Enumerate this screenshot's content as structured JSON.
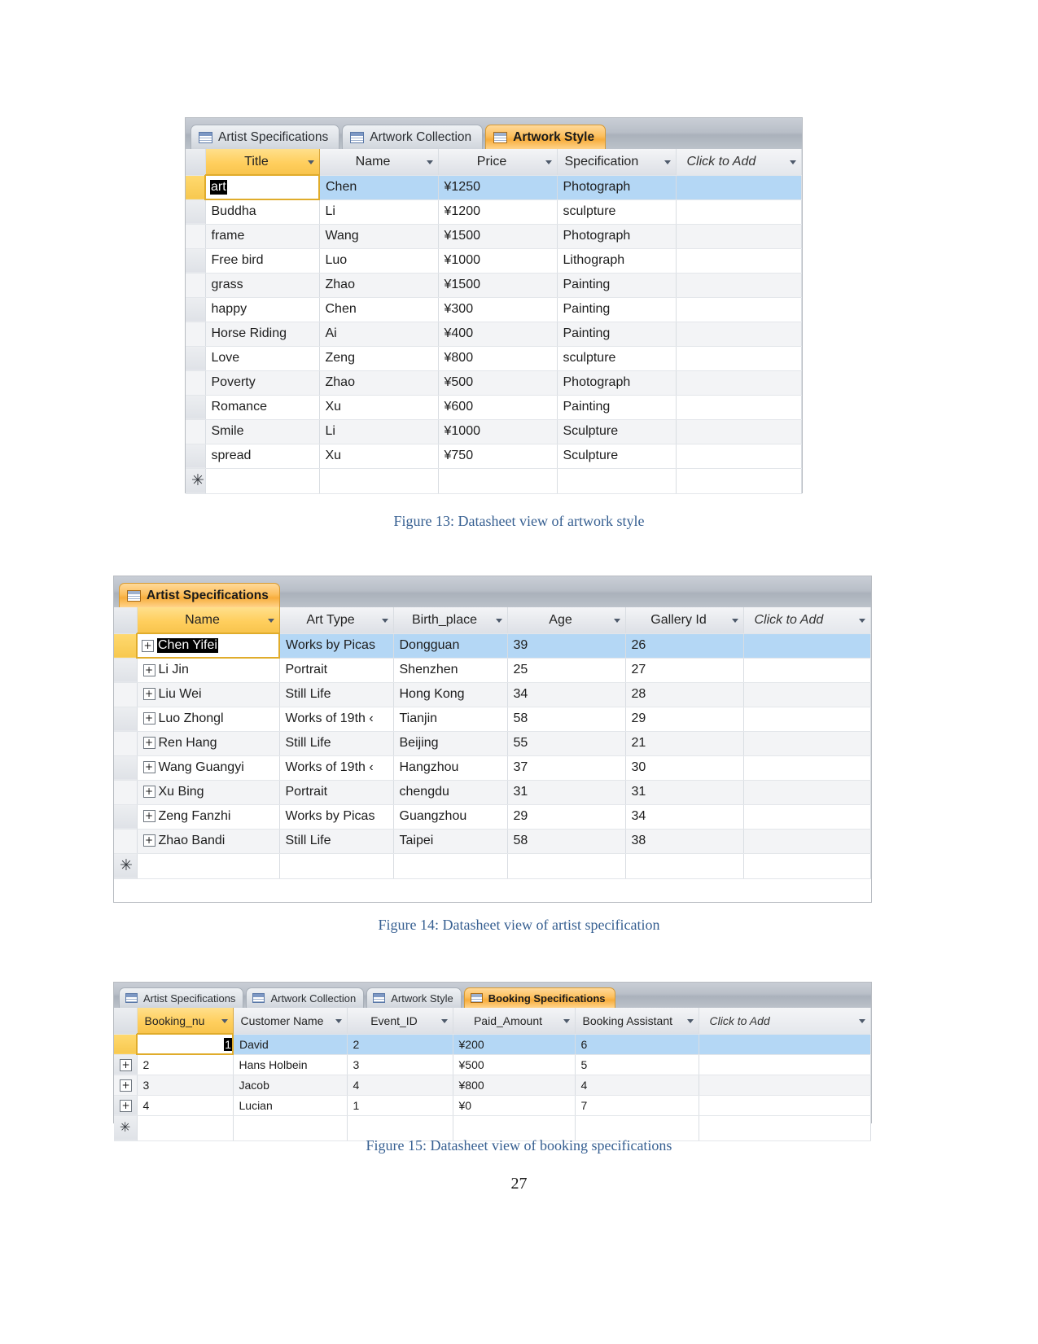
{
  "figure13": {
    "tabs": [
      {
        "label": "Artist Specifications",
        "active": false
      },
      {
        "label": "Artwork Collection",
        "active": false
      },
      {
        "label": "Artwork Style",
        "active": true
      }
    ],
    "columns": [
      "Title",
      "Name",
      "Price",
      "Specification",
      "Click to Add"
    ],
    "selected_column": "Title",
    "editing_cell_value": "art",
    "rows": [
      {
        "title": "art",
        "name": "Chen",
        "price": "¥1250",
        "specification": "Photograph"
      },
      {
        "title": "Buddha",
        "name": "Li",
        "price": "¥1200",
        "specification": "sculpture"
      },
      {
        "title": "frame",
        "name": "Wang",
        "price": "¥1500",
        "specification": "Photograph"
      },
      {
        "title": "Free bird",
        "name": "Luo",
        "price": "¥1000",
        "specification": "Lithograph"
      },
      {
        "title": "grass",
        "name": "Zhao",
        "price": "¥1500",
        "specification": "Painting"
      },
      {
        "title": "happy",
        "name": "Chen",
        "price": "¥300",
        "specification": "Painting"
      },
      {
        "title": "Horse Riding",
        "name": "Ai",
        "price": "¥400",
        "specification": "Painting"
      },
      {
        "title": "Love",
        "name": "Zeng",
        "price": "¥800",
        "specification": "sculpture"
      },
      {
        "title": "Poverty",
        "name": "Zhao",
        "price": "¥500",
        "specification": "Photograph"
      },
      {
        "title": "Romance",
        "name": "Xu",
        "price": "¥600",
        "specification": "Painting"
      },
      {
        "title": "Smile",
        "name": "Li",
        "price": "¥1000",
        "specification": "Sculpture"
      },
      {
        "title": "spread",
        "name": "Xu",
        "price": "¥750",
        "specification": "Sculpture"
      }
    ],
    "new_row_marker": "✳",
    "caption": "Figure 13: Datasheet view of artwork style"
  },
  "figure14": {
    "tabs": [
      {
        "label": "Artist Specifications",
        "active": true
      }
    ],
    "columns": [
      "Name",
      "Art Type",
      "Birth_place",
      "Age",
      "Gallery Id",
      "Click to Add"
    ],
    "selected_column": "Name",
    "editing_cell_value": "Chen Yifei",
    "rows": [
      {
        "name": "Chen Yifei",
        "art_type": "Works by Picas",
        "birth_place": "Dongguan",
        "age": "39",
        "gallery_id": "26"
      },
      {
        "name": "Li Jin",
        "art_type": "Portrait",
        "birth_place": "Shenzhen",
        "age": "25",
        "gallery_id": "27"
      },
      {
        "name": "Liu Wei",
        "art_type": "Still Life",
        "birth_place": "Hong Kong",
        "age": "34",
        "gallery_id": "28"
      },
      {
        "name": "Luo Zhongl",
        "art_type": "Works of 19th ‹",
        "birth_place": "Tianjin",
        "age": "58",
        "gallery_id": "29"
      },
      {
        "name": "Ren Hang",
        "art_type": "Still Life",
        "birth_place": "Beijing",
        "age": "55",
        "gallery_id": "21"
      },
      {
        "name": "Wang Guangyi",
        "art_type": "Works of 19th ‹",
        "birth_place": "Hangzhou",
        "age": "37",
        "gallery_id": "30"
      },
      {
        "name": "Xu Bing",
        "art_type": "Portrait",
        "birth_place": "chengdu",
        "age": "31",
        "gallery_id": "31"
      },
      {
        "name": "Zeng Fanzhi",
        "art_type": "Works by Picas",
        "birth_place": "Guangzhou",
        "age": "29",
        "gallery_id": "34"
      },
      {
        "name": "Zhao Bandi",
        "art_type": "Still Life",
        "birth_place": "Taipei",
        "age": "58",
        "gallery_id": "38"
      }
    ],
    "expander_symbol": "+",
    "new_row_marker": "✳",
    "caption": "Figure 14: Datasheet view of artist specification"
  },
  "figure15": {
    "tabs": [
      {
        "label": "Artist Specifications",
        "active": false
      },
      {
        "label": "Artwork Collection",
        "active": false
      },
      {
        "label": "Artwork Style",
        "active": false
      },
      {
        "label": "Booking Specifications",
        "active": true
      }
    ],
    "columns": [
      "Booking_nu",
      "Customer Name",
      "Event_ID",
      "Paid_Amount",
      "Booking Assistant",
      "Click to Add"
    ],
    "selected_column": "Booking_nu",
    "editing_cell_value": "1",
    "rows": [
      {
        "booking_number": "1",
        "customer_name": "David",
        "event_id": "2",
        "paid_amount": "¥200",
        "booking_assistant": "6"
      },
      {
        "booking_number": "2",
        "customer_name": "Hans Holbein",
        "event_id": "3",
        "paid_amount": "¥500",
        "booking_assistant": "5"
      },
      {
        "booking_number": "3",
        "customer_name": "Jacob",
        "event_id": "4",
        "paid_amount": "¥800",
        "booking_assistant": "4"
      },
      {
        "booking_number": "4",
        "customer_name": "Lucian",
        "event_id": "1",
        "paid_amount": "¥0",
        "booking_assistant": "7"
      }
    ],
    "expander_symbol": "+",
    "new_row_marker": "✳",
    "caption": "Figure 15: Datasheet view of booking specifications"
  },
  "page_number": "27"
}
